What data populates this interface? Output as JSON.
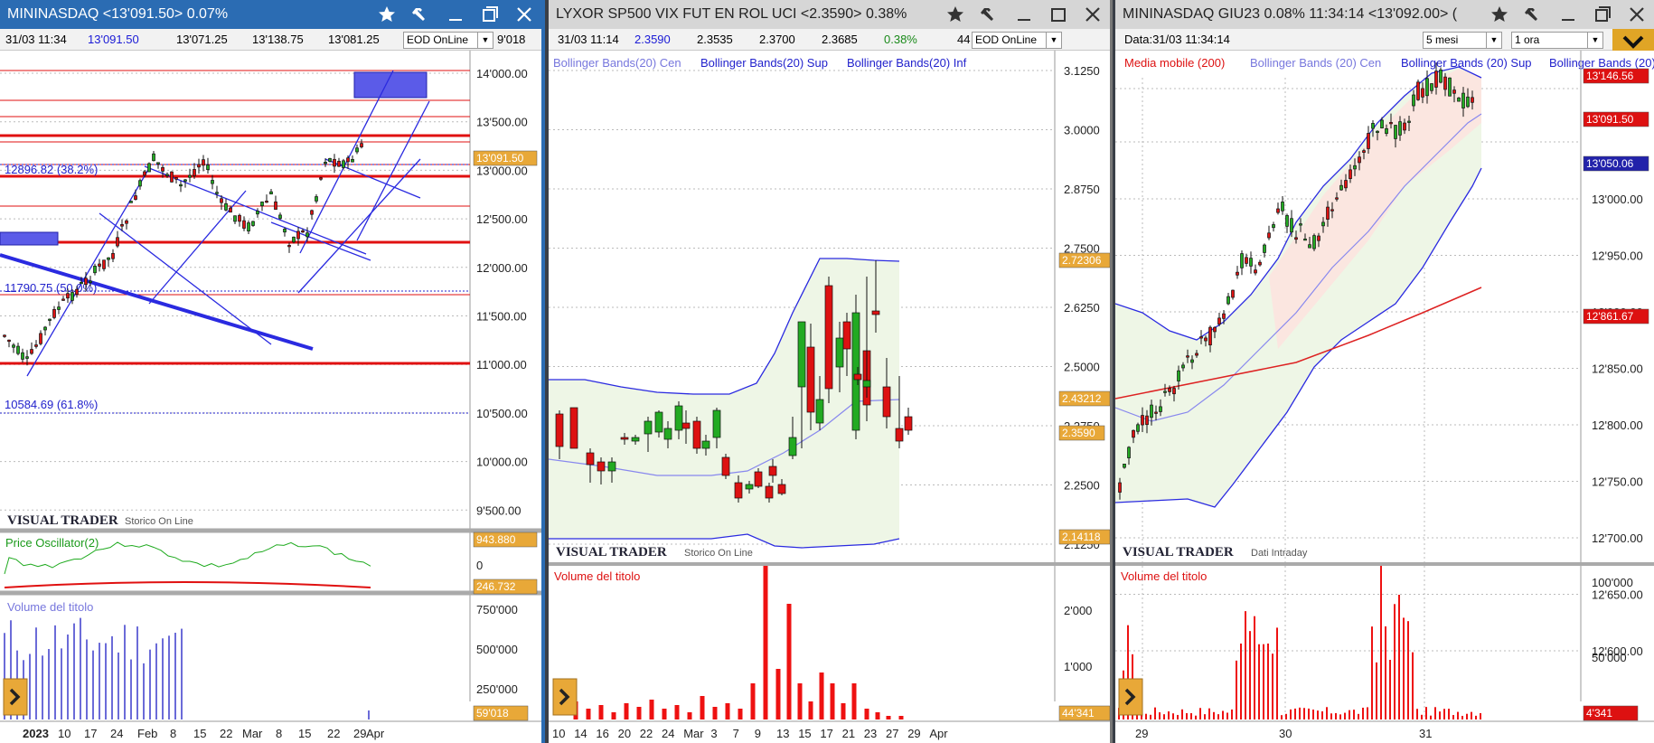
{
  "windows": [
    {
      "title": "MININASDAQ <13'091.50> 0.07%",
      "info": {
        "date": "31/03 11:34",
        "last": "13'091.50",
        "low": "13'071.25",
        "high": "13'138.75",
        "open": "13'081.25",
        "feed": "EOD OnLine",
        "extra": "9'018"
      },
      "price_axis": [
        "14'000.00",
        "13'500.00",
        "13'000.00",
        "12'500.00",
        "12'000.00",
        "11'500.00",
        "11'000.00",
        "10'500.00",
        "10'000.00",
        "9'500.00"
      ],
      "tags": {
        "last": "13'091.50",
        "osc": "943.880",
        "osc2": "246.732",
        "vol": "59'018"
      },
      "fib": [
        "12896.82 (38.2%)",
        "11790.75 (50.0%)",
        "10584.69 (61.8%)"
      ],
      "brand": "VISUAL TRADER",
      "brand_sub": "Storico On Line",
      "osc_label": "Price Oscillator(2)",
      "osc_axis": [
        "0"
      ],
      "vol_label": "Volume del titolo",
      "vol_axis": [
        "750'000",
        "500'000",
        "250'000"
      ],
      "x_axis": [
        "2023",
        "10",
        "17",
        "24",
        "Feb",
        "8",
        "15",
        "22",
        "Mar",
        "8",
        "15",
        "22",
        "29",
        "Apr"
      ]
    },
    {
      "title": "LYXOR SP500 VIX FUT EN ROL UCI <2.3590> 0.38%",
      "info": {
        "date": "31/03 11:14",
        "last": "2.3590",
        "low": "2.3535",
        "high": "2.3700",
        "open": "2.3685",
        "chg": "0.38%",
        "extra": "44",
        "feed": "EOD OnLine"
      },
      "legend": [
        "Bollinger Bands(20) Cen",
        "Bollinger Bands(20) Sup",
        "Bollinger Bands(20) Inf"
      ],
      "price_axis": [
        "3.1250",
        "3.0000",
        "2.8750",
        "2.7500",
        "2.6250",
        "2.5000",
        "2.3750",
        "2.2500",
        "2.1250"
      ],
      "tags": {
        "sup": "2.72306",
        "cen": "2.43212",
        "last": "2.3590",
        "inf": "2.14118",
        "vol": "44'341"
      },
      "brand": "VISUAL TRADER",
      "brand_sub": "Storico On Line",
      "vol_label": "Volume del titolo",
      "vol_axis": [
        "2'000",
        "1'000"
      ],
      "x_axis": [
        "10",
        "14",
        "16",
        "20",
        "22",
        "24",
        "Mar",
        "3",
        "7",
        "9",
        "13",
        "15",
        "17",
        "21",
        "23",
        "27",
        "29",
        "Apr"
      ]
    },
    {
      "title": "MININASDAQ GIU23 0.08% 11:34:14 <13'092.00> (",
      "info": {
        "date": "Data:31/03 11:34:14",
        "range": "5 mesi",
        "tf": "1 ora"
      },
      "legend": [
        "Media mobile (200)",
        "Bollinger Bands (20) Cen",
        "Bollinger Bands (20) Sup",
        "Bollinger Bands (20) Inf"
      ],
      "price_axis": [
        "13'000.00",
        "12'950.00",
        "12'900.00",
        "12'850.00",
        "12'800.00",
        "12'750.00",
        "12'700.00",
        "12'650.00",
        "12'600.00"
      ],
      "tags": {
        "sup": "13'146.56",
        "last": "13'091.50",
        "cen": "13'050.06",
        "ma": "12'861.67",
        "vol": "4'341"
      },
      "brand": "VISUAL TRADER",
      "brand_sub": "Dati Intraday",
      "vol_label": "Volume del titolo",
      "vol_axis": [
        "100'000",
        "50'000"
      ],
      "x_axis": [
        "29",
        "30",
        "31"
      ]
    }
  ],
  "colors": {
    "title_active": "#2b6cb3",
    "title_inactive": "#d6d6d6",
    "up": "#22aa22",
    "down": "#dd1111",
    "line": "#1a1ad6",
    "level": "#e01010",
    "tag_gold": "#e8a838"
  }
}
